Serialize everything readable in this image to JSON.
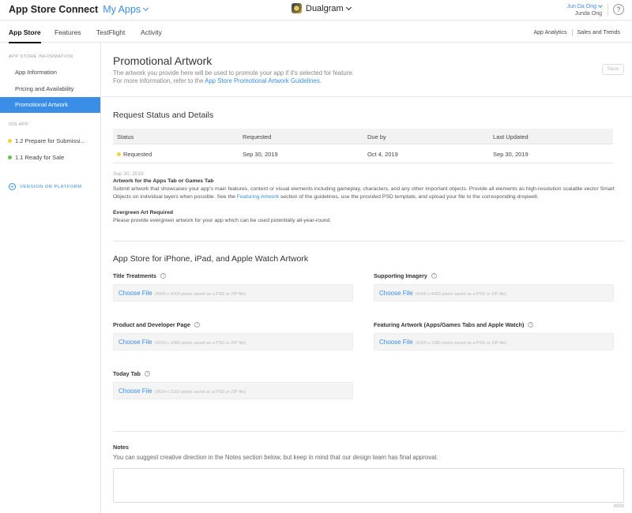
{
  "topbar": {
    "brand": "App Store Connect",
    "my_apps": "My Apps",
    "app_name": "Dualgram",
    "user_name": "Jun Da Ong",
    "user_sub": "Junda Ong",
    "help": "?"
  },
  "tabs": {
    "app_store": "App Store",
    "features": "Features",
    "testflight": "TestFlight",
    "activity": "Activity",
    "app_analytics": "App Analytics",
    "sales_trends": "Sales and Trends"
  },
  "sidebar": {
    "section1": "APP STORE INFORMATION",
    "items": [
      {
        "label": "App Information"
      },
      {
        "label": "Pricing and Availability"
      },
      {
        "label": "Promotional Artwork"
      }
    ],
    "section2": "IOS APP",
    "versions": [
      {
        "label": "1.2 Prepare for Submissi...",
        "status_color": "#f2d33c"
      },
      {
        "label": "1.1 Ready for Sale",
        "status_color": "#6cc04a"
      }
    ],
    "add_version": "VERSION OR PLATFORM"
  },
  "main": {
    "title": "Promotional Artwork",
    "subtitle1": "The artwork you provide here will be used to promote your app if it's selected for feature.",
    "subtitle2_pre": "For more information, refer to the ",
    "subtitle2_link": "App Store Promotional Artwork Guidelines",
    "subtitle2_post": ".",
    "save": "Save"
  },
  "request": {
    "heading": "Request Status and Details",
    "columns": [
      "Status",
      "Requested",
      "Due by",
      "Last Updated"
    ],
    "row": {
      "status": "Requested",
      "requested": "Sep 30, 2019",
      "due": "Oct 4, 2019",
      "updated": "Sep 30, 2019"
    },
    "note_date": "Sep 30, 2019",
    "note1_title": "Artwork for the Apps Tab or Games Tab",
    "note1_text_pre": "Submit artwork that showcases your app's main features, content or visual elements including gameplay, characters, and any other important objects. Provide all elements as high-resolution scalable vector Smart Objects on individual layers when possible. See the ",
    "note1_link": "Featuring Artwork",
    "note1_text_post": " section of the guidelines, use the provided PSD template, and upload your file to the corresponding dropwell.",
    "note2_title": "Evergreen Art Required",
    "note2_text": "Please provide evergreen artwork for your app which can be used potentially all-year-round."
  },
  "artwork": {
    "heading": "App Store for iPhone, iPad, and Apple Watch Artwork",
    "choose": "Choose File",
    "fields": [
      {
        "label": "Title Treatments",
        "hint": "(4000 x 4000 pixels saved as a PSD or ZIP file)"
      },
      {
        "label": "Supporting Imagery",
        "hint": "(4000 x 4000 pixels saved as a PSD or ZIP file)"
      },
      {
        "label": "Product and Developer Page",
        "hint": "(4320 x 1080 pixels saved as a PSD or ZIP file)"
      },
      {
        "label": "Featuring Artwork (Apps/Games Tabs and Apple Watch)",
        "hint": "(4320 x 1080 pixels saved as a PSD or ZIP file)"
      },
      {
        "label": "Today Tab",
        "hint": "(3624 x 2160 pixels saved as a PSD or ZIP file)"
      }
    ]
  },
  "notes": {
    "title": "Notes",
    "subtitle": "You can suggest creative direction in the Notes section below, but keep in mind that our design team has final approval.",
    "count": "4000"
  }
}
